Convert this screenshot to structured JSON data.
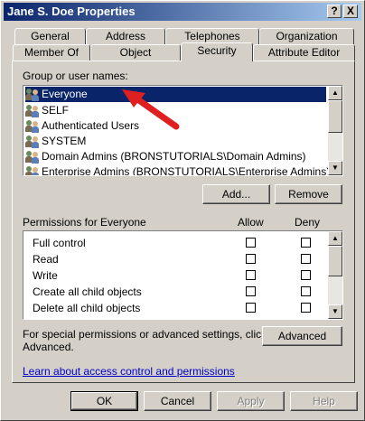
{
  "window": {
    "title": "Jane S. Doe Properties",
    "help_btn": "?",
    "close_btn": "X"
  },
  "tabs_back": [
    "General",
    "Address",
    "Telephones",
    "Organization"
  ],
  "tabs_front": [
    "Member Of",
    "Object",
    "Security",
    "Attribute Editor"
  ],
  "active_tab": "Security",
  "group_label": "Group or user names:",
  "users": [
    {
      "name": "Everyone",
      "selected": true
    },
    {
      "name": "SELF",
      "selected": false
    },
    {
      "name": "Authenticated Users",
      "selected": false
    },
    {
      "name": "SYSTEM",
      "selected": false
    },
    {
      "name": "Domain Admins (BRONSTUTORIALS\\Domain Admins)",
      "selected": false
    },
    {
      "name": "Enterprise Admins (BRONSTUTORIALS\\Enterprise Admins)",
      "selected": false
    }
  ],
  "buttons": {
    "add": "Add...",
    "remove": "Remove",
    "advanced": "Advanced",
    "ok": "OK",
    "cancel": "Cancel",
    "apply": "Apply",
    "help": "Help"
  },
  "permissions": {
    "label": "Permissions for Everyone",
    "allow_header": "Allow",
    "deny_header": "Deny",
    "items": [
      {
        "name": "Full control",
        "allow": false,
        "deny": false
      },
      {
        "name": "Read",
        "allow": false,
        "deny": false
      },
      {
        "name": "Write",
        "allow": false,
        "deny": false
      },
      {
        "name": "Create all child objects",
        "allow": false,
        "deny": false
      },
      {
        "name": "Delete all child objects",
        "allow": false,
        "deny": false
      }
    ]
  },
  "special_text_line1": "For special permissions or advanced settings, click",
  "special_text_line2": "Advanced.",
  "link_text": "Learn about access control and permissions",
  "colors": {
    "titlebar": "#0a246a",
    "selection": "#0a246a",
    "annotation_arrow": "#e02020",
    "face": "#d4d0c8"
  }
}
